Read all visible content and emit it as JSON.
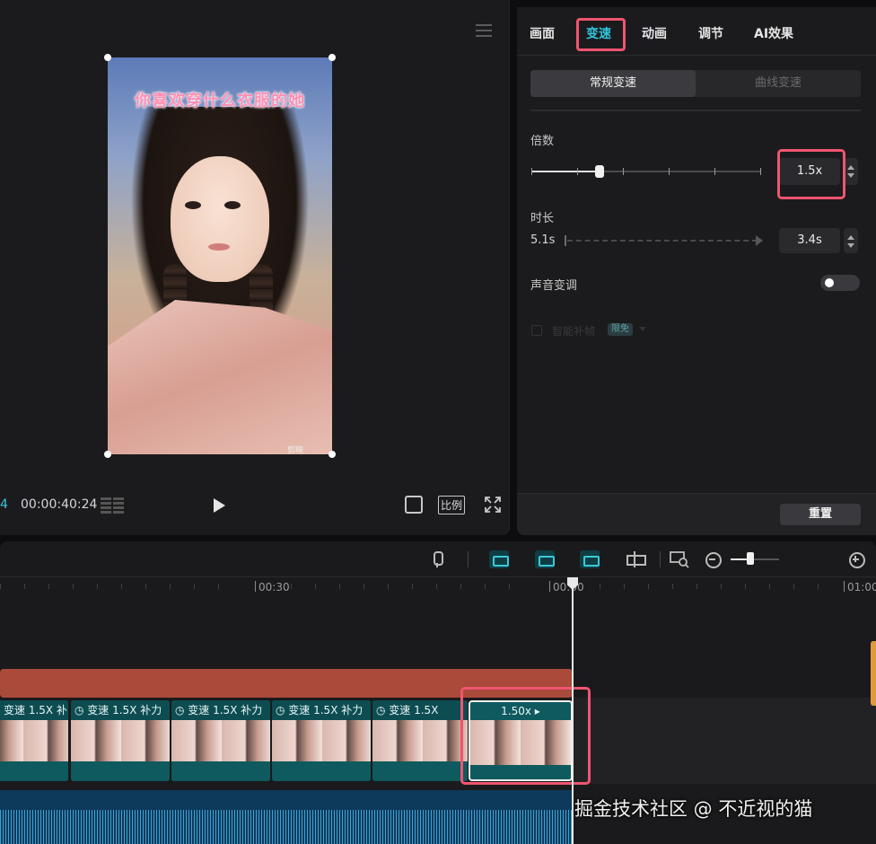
{
  "player": {
    "timecode_prefix": "4",
    "timecode": "00:00:40:24",
    "ratio_label": "比例",
    "video": {
      "caption": "你喜欢穿什么衣服的她",
      "corner_mark": "剪映"
    }
  },
  "properties": {
    "tabs": [
      "画面",
      "变速",
      "动画",
      "调节",
      "AI效果"
    ],
    "active_tab": "变速",
    "segments": {
      "normal": "常规变速",
      "curve": "曲线变速"
    },
    "speed": {
      "label": "倍数",
      "value": "1.5x",
      "slider_fraction": 0.3
    },
    "duration": {
      "label": "时长",
      "original": "5.1s",
      "value": "3.4s"
    },
    "pitch": {
      "label": "声音变调",
      "enabled": false
    },
    "frame_interp": {
      "label": "智能补帧",
      "badge": "限免"
    },
    "reset_label": "重置"
  },
  "timeline": {
    "ruler_labels": [
      "00:30",
      "00:00",
      "01:00"
    ],
    "clip_label": "变速 1.5X",
    "clip_suffix": "补力",
    "last_clip_label": "1.50x ▸",
    "zoom_fraction": 0.4
  },
  "watermark": "掘金技术社区 @ 不近视的猫",
  "colors": {
    "accent": "#30c5dc",
    "highlight": "#f0556f",
    "text_track": "#a94a3a",
    "video_clip": "#0f5a5e",
    "audio": "#0d3a5a"
  }
}
